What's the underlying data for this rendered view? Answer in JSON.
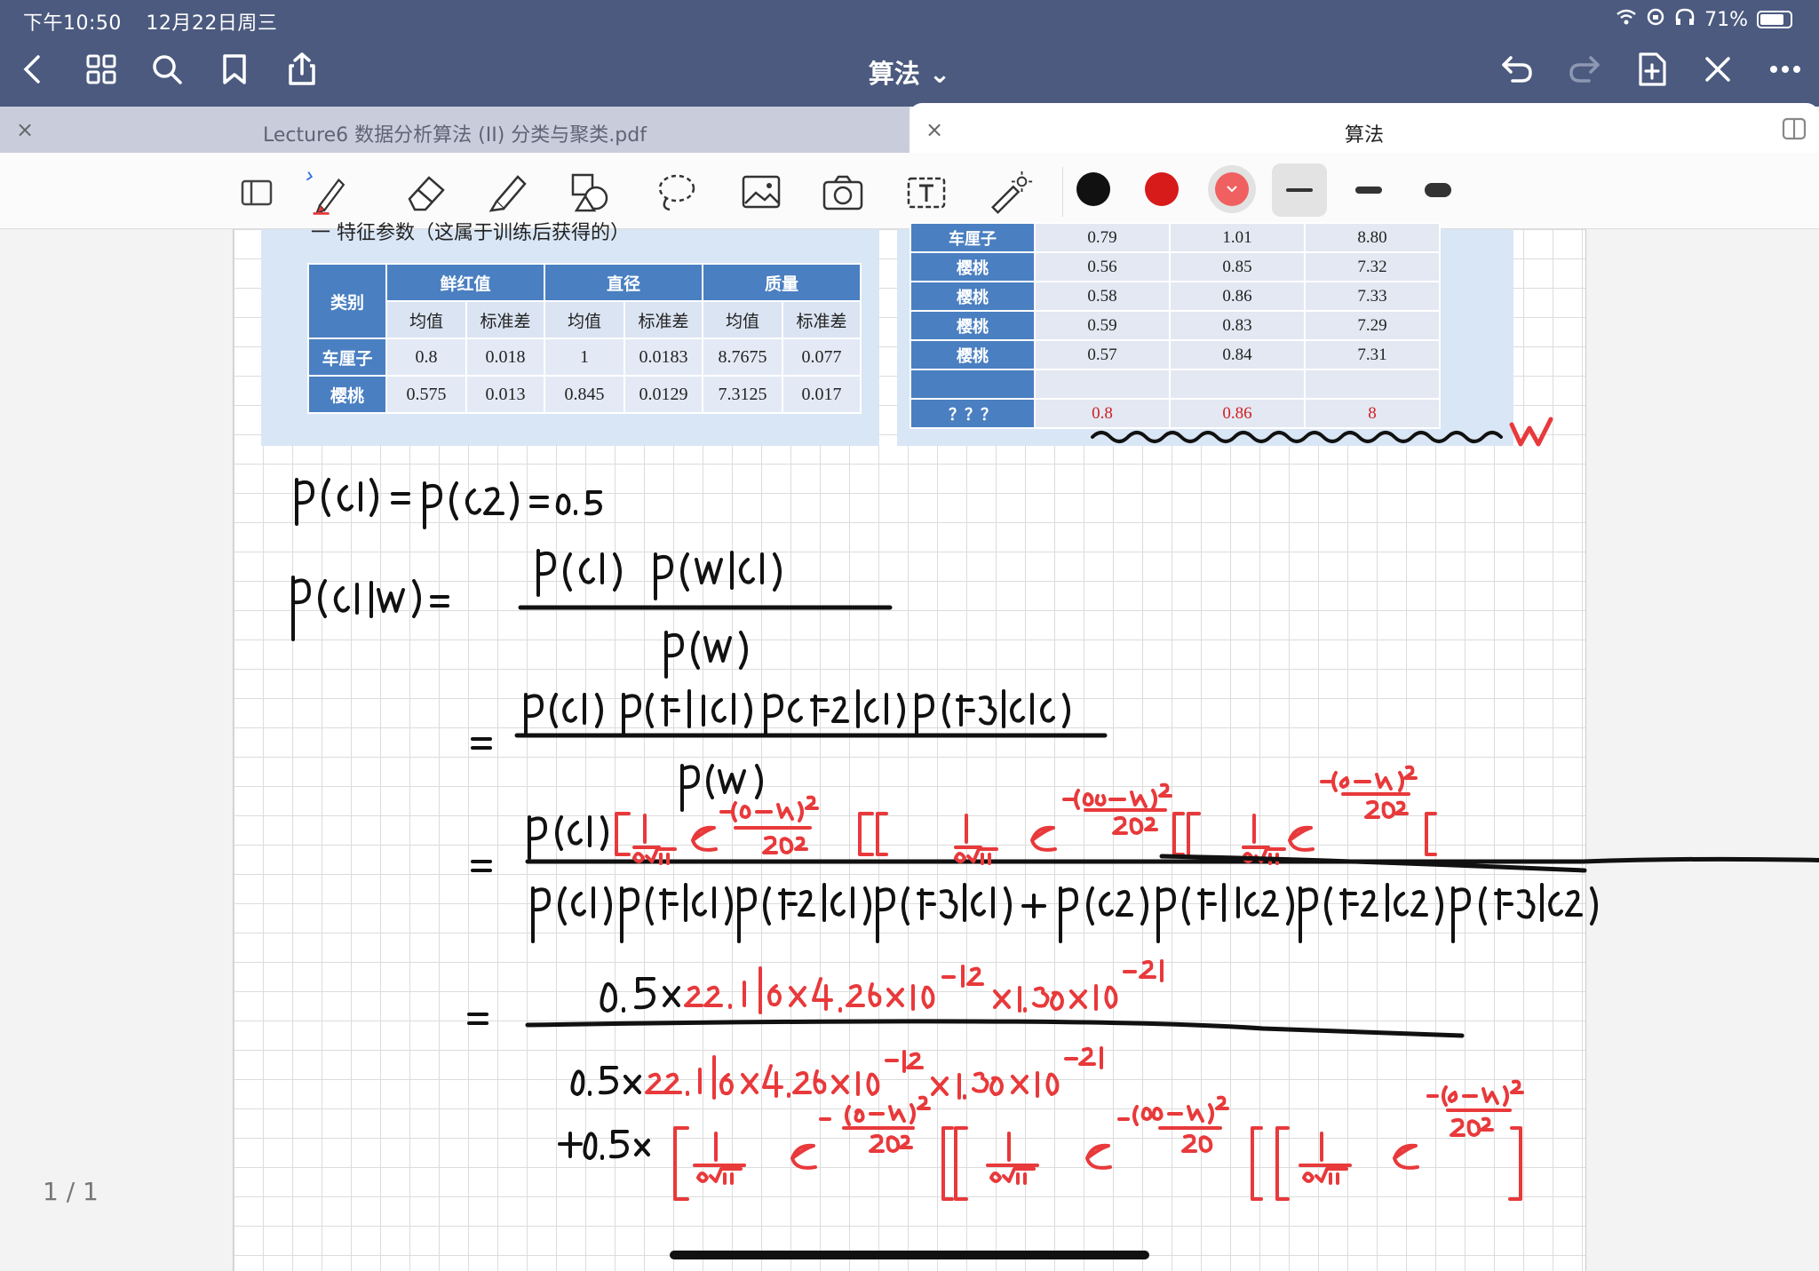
{
  "status_bar": {
    "time": "下午10:50",
    "date": "12月22日周三",
    "battery": "71%"
  },
  "title_bar": {
    "title": "算法 ⌄"
  },
  "tabs": [
    {
      "label": "Lecture6 数据分析算法 (II) 分类与聚类.pdf",
      "active": false
    },
    {
      "label": "算法",
      "active": true
    }
  ],
  "toolbar": {
    "colors": [
      "#111111",
      "#d71a1a",
      "#f06060"
    ],
    "selected_color": "#f06060",
    "stroke_widths": [
      "thin",
      "medium",
      "thick"
    ],
    "selected_stroke": "thin"
  },
  "slide1": {
    "heading": "一 特征参数（这属于训练后获得的）",
    "header_row1": [
      "类别",
      "鲜红值",
      "直径",
      "质量"
    ],
    "header_row2": [
      "均值",
      "标准差",
      "均值",
      "标准差",
      "均值",
      "标准差"
    ],
    "rows": [
      {
        "label": "车厘子",
        "values": [
          "0.8",
          "0.018",
          "1",
          "0.0183",
          "8.7675",
          "0.077"
        ]
      },
      {
        "label": "樱桃",
        "values": [
          "0.575",
          "0.013",
          "0.845",
          "0.0129",
          "7.3125",
          "0.017"
        ]
      }
    ]
  },
  "slide2": {
    "rows": [
      {
        "label": "车厘子",
        "values": [
          "0.79",
          "1.01",
          "8.80"
        ]
      },
      {
        "label": "樱桃",
        "values": [
          "0.56",
          "0.85",
          "7.32"
        ]
      },
      {
        "label": "樱桃",
        "values": [
          "0.58",
          "0.86",
          "7.33"
        ]
      },
      {
        "label": "樱桃",
        "values": [
          "0.59",
          "0.83",
          "7.29"
        ]
      },
      {
        "label": "樱桃",
        "values": [
          "0.57",
          "0.84",
          "7.31"
        ]
      },
      {
        "label": "",
        "values": [
          "",
          "",
          ""
        ]
      },
      {
        "label": "？？？",
        "values": [
          "0.8",
          "0.86",
          "8"
        ]
      }
    ]
  },
  "handwriting": {
    "line1": "p(C1) = p(C2) = 0.5",
    "line2": "p(C1|W) = p(C1) p(W|C1) / p(W)",
    "line3": "= p(C1) p(F1|C1) p(F2|C1) p(F3|C1) / p(W)",
    "line4": "= p(C1)[1/(σ√2π) e^-(0.8-μ)²/2σ²][1/(σ√2π) e^-(0.86-μ)²/2σ²][1/(σ√2π) e^-(8-μ)²/2σ²] / p(C1)p(F1|C1)p(F2|C1)p(F3|C1) + p(C2)p(F1|C2)p(F2|C2)p(F3|C2)",
    "line5": "= 0.5×22.16×4.26×10^-12×1.38×10^-21 / 0.5×22.16×4.26×10^-12×1.38×10^-21 + 0.5×[...][...][...]",
    "label_w": "W"
  },
  "page_indicator": "1 / 1"
}
